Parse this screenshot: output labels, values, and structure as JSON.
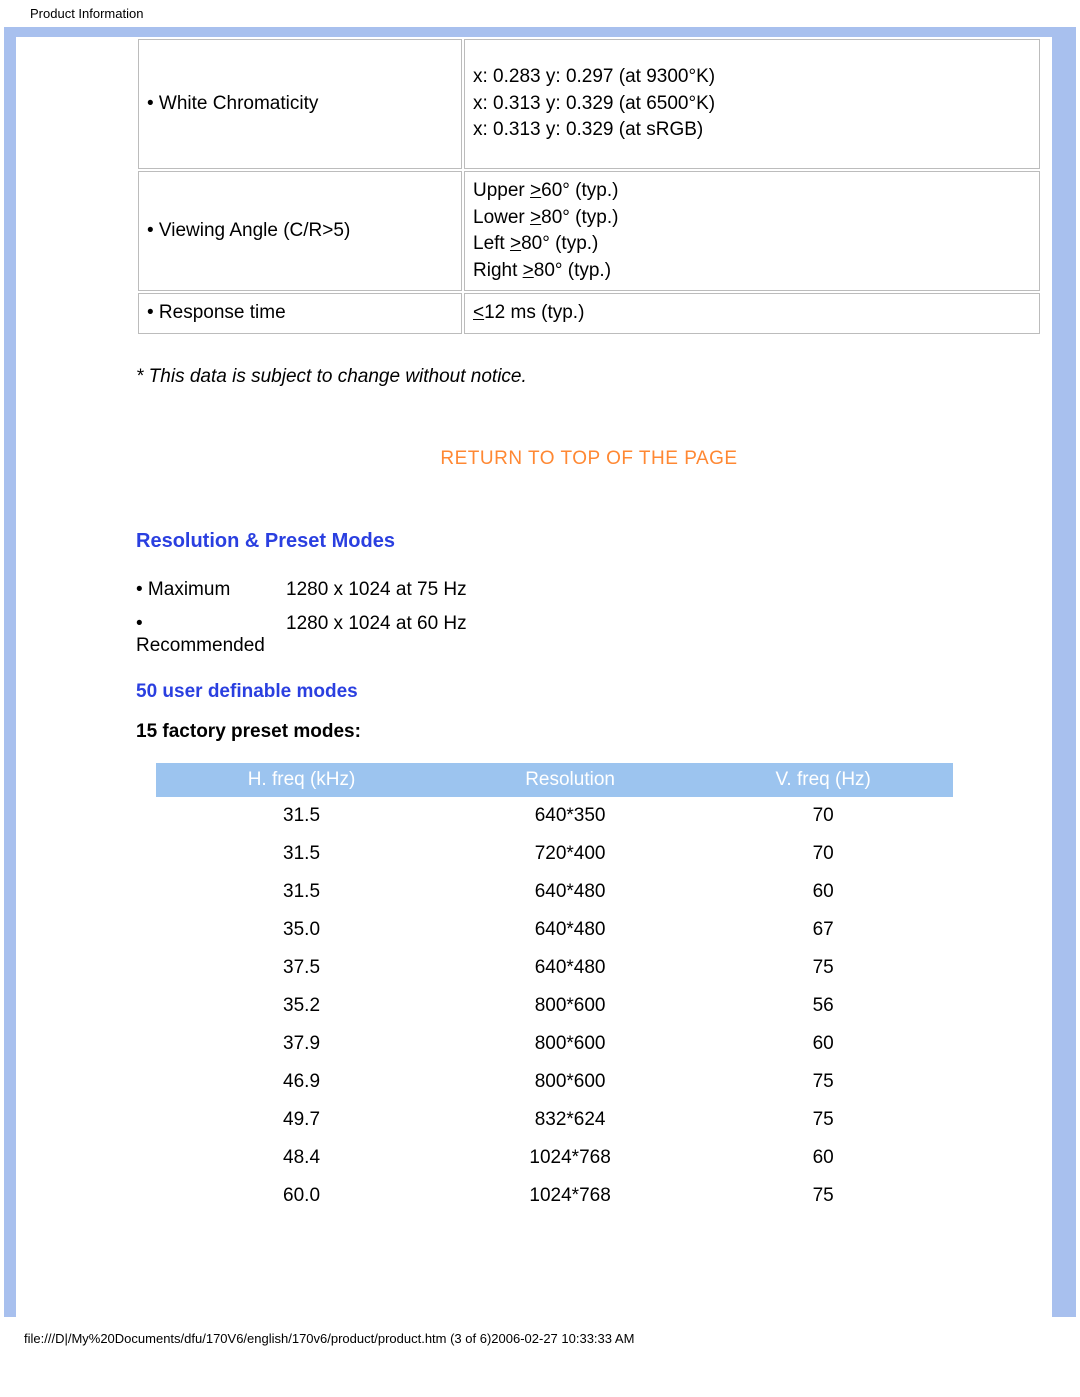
{
  "page_title": "Product Information",
  "spec_table": {
    "rows": [
      {
        "label": "• White Chromaticity",
        "value_html": "x: 0.283 y: 0.297 (at 9300°K)<br>x: 0.313 y: 0.329 (at 6500°K)<br>x: 0.313 y: 0.329 (at sRGB)",
        "cls": "tall"
      },
      {
        "label": "• Viewing Angle (C/R>5)",
        "value_html": "Upper <span class='underline'>&gt;</span>60° (typ.)<br>Lower <span class='underline'>&gt;</span>80° (typ.)<br>Left <span class='underline'>&gt;</span>80° (typ.)<br>Right <span class='underline'>&gt;</span>80° (typ.)",
        "cls": "med"
      },
      {
        "label": "• Response time",
        "value_html": "<span class='underline'>&lt;</span>12 ms (typ.)",
        "cls": ""
      }
    ]
  },
  "notice": "* This data is subject to change without notice.",
  "return_link": "RETURN TO TOP OF THE PAGE",
  "section_heading": "Resolution & Preset Modes",
  "modes": {
    "max_label": "• Maximum",
    "max_value": "1280 x 1024 at 75 Hz",
    "rec_label": "• Recommended",
    "rec_value": "1280 x 1024 at 60 Hz"
  },
  "user_modes_heading": "50 user definable modes",
  "factory_heading": "15 factory preset modes:",
  "preset_table": {
    "headers": [
      "H. freq (kHz)",
      "Resolution",
      "V. freq (Hz)"
    ],
    "rows": [
      [
        "31.5",
        "640*350",
        "70"
      ],
      [
        "31.5",
        "720*400",
        "70"
      ],
      [
        "31.5",
        "640*480",
        "60"
      ],
      [
        "35.0",
        "640*480",
        "67"
      ],
      [
        "37.5",
        "640*480",
        "75"
      ],
      [
        "35.2",
        "800*600",
        "56"
      ],
      [
        "37.9",
        "800*600",
        "60"
      ],
      [
        "46.9",
        "800*600",
        "75"
      ],
      [
        "49.7",
        "832*624",
        "75"
      ],
      [
        "48.4",
        "1024*768",
        "60"
      ],
      [
        "60.0",
        "1024*768",
        "75"
      ]
    ]
  },
  "footer": "file:///D|/My%20Documents/dfu/170V6/english/170v6/product/product.htm (3 of 6)2006-02-27 10:33:33 AM"
}
